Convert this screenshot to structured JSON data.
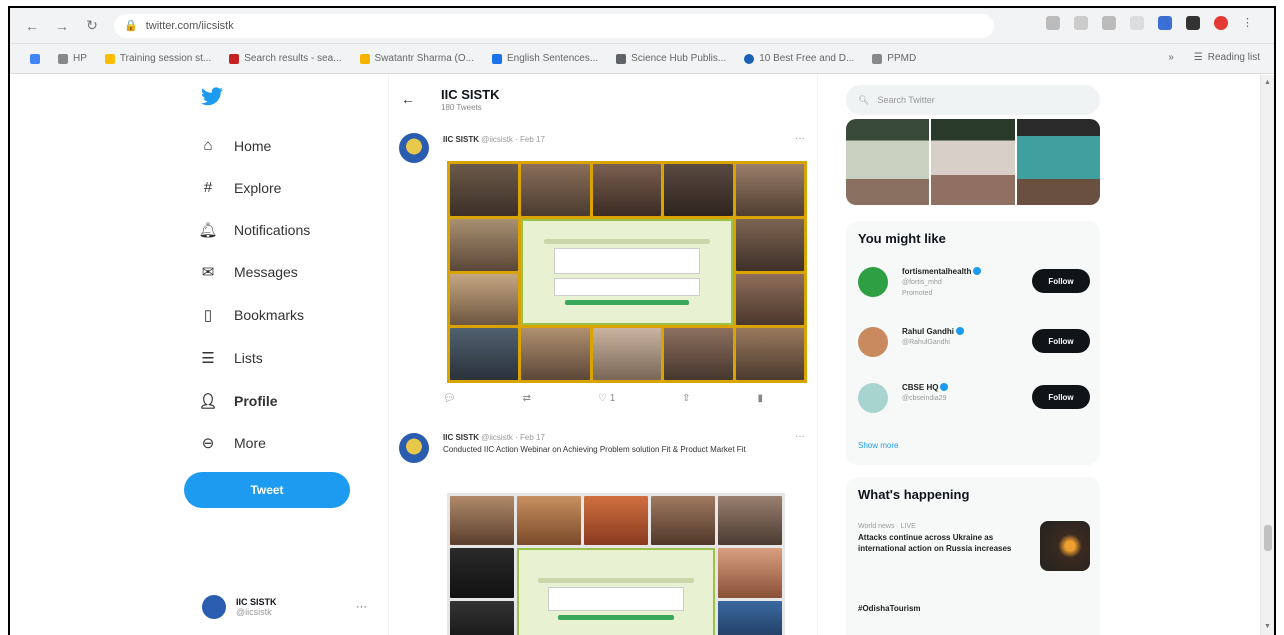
{
  "browser": {
    "url": "twitter.com/iicsistk",
    "bookmarks": [
      "HP",
      "Training session st...",
      "Search results - sea...",
      "Swatantr Sharma (O...",
      "English Sentences...",
      "Science Hub Publis...",
      "10 Best Free and D...",
      "PPMD"
    ],
    "reading_list": "Reading list"
  },
  "sidebar": {
    "items": [
      {
        "label": "Home",
        "icon": "home-icon"
      },
      {
        "label": "Explore",
        "icon": "hashtag-icon"
      },
      {
        "label": "Notifications",
        "icon": "bell-icon"
      },
      {
        "label": "Messages",
        "icon": "mail-icon"
      },
      {
        "label": "Bookmarks",
        "icon": "bookmark-icon"
      },
      {
        "label": "Lists",
        "icon": "list-icon"
      },
      {
        "label": "Profile",
        "icon": "person-icon"
      },
      {
        "label": "More",
        "icon": "more-circle-icon"
      }
    ],
    "tweet_button": "Tweet",
    "account": {
      "name": "IIC SISTK",
      "handle": "@iicsistk",
      "more": "···"
    }
  },
  "timeline": {
    "title": "IIC SISTK",
    "subtitle": "180 Tweets",
    "tweets": [
      {
        "author": "IIC SISTK",
        "handle": "@iicsistk · Feb 17",
        "text": "",
        "actions": {
          "reply": "",
          "retweet": "",
          "like": "1",
          "share": ""
        }
      },
      {
        "author": "IIC SISTK",
        "handle": "@iicsistk · Feb 17",
        "text": "Conducted IIC Action Webinar on Achieving Problem solution Fit & Product Market Fit"
      }
    ]
  },
  "right": {
    "search_placeholder": "Search Twitter",
    "you_might_like": {
      "title": "You might like",
      "suggestions": [
        {
          "name": "fortismentalhealth",
          "handle": "@fortis_mhd",
          "extra": "Promoted",
          "follow": "Follow",
          "avatar_color": "#2ea043"
        },
        {
          "name": "Rahul Gandhi",
          "handle": "@RahulGandhi",
          "extra": "",
          "follow": "Follow",
          "avatar_color": "#c98a60"
        },
        {
          "name": "CBSE HQ",
          "handle": "@cbseindia29",
          "extra": "",
          "follow": "Follow",
          "avatar_color": "#a8d4d0"
        }
      ],
      "show_more": "Show more"
    },
    "whats_happening": {
      "title": "What's happening",
      "trends": [
        {
          "context": "World news · LIVE",
          "headline": "Attacks continue across Ukraine as international action on Russia increases"
        },
        {
          "context": "",
          "headline": "#OdishaTourism"
        }
      ]
    }
  }
}
